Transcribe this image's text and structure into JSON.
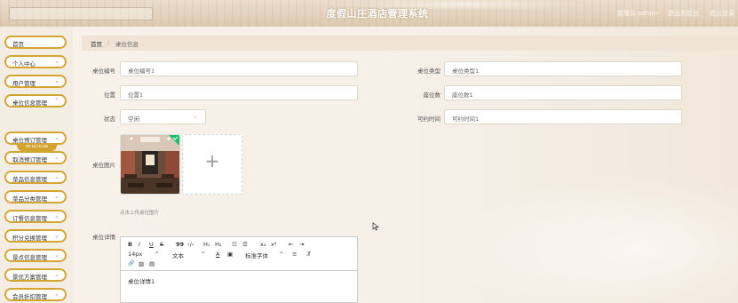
{
  "header": {
    "title": "度假山庄酒店管理系统",
    "links": [
      "管理员 admin",
      "退出到前台",
      "退出登录"
    ]
  },
  "sidebar": {
    "items": [
      {
        "label": "首页",
        "chev": ""
      },
      {
        "label": "个人中心",
        "chev": "⌄"
      },
      {
        "label": "用户管理",
        "chev": "⌄"
      },
      {
        "label": "桌位信息管理",
        "chev": "⌃"
      },
      {
        "label": "桌位预订管理",
        "chev": "⌄"
      },
      {
        "label": "取消预订管理",
        "chev": "⌄"
      },
      {
        "label": "菜品信息管理",
        "chev": "⌄"
      },
      {
        "label": "菜品分类管理",
        "chev": "⌄"
      },
      {
        "label": "订餐信息管理",
        "chev": "⌄"
      },
      {
        "label": "积分兑换管理",
        "chev": "⌄"
      },
      {
        "label": "景点信息管理",
        "chev": "⌄"
      },
      {
        "label": "景优方案管理",
        "chev": "⌄"
      },
      {
        "label": "会员折扣管理",
        "chev": "⌄"
      }
    ],
    "active_submenu": "桌位信息"
  },
  "breadcrumb": {
    "home": "首页",
    "separator": "/",
    "current": "桌位信息"
  },
  "form": {
    "table_no_label": "桌位编号",
    "table_no_value": "桌位编号1",
    "table_type_label": "桌位类型",
    "table_type_value": "桌位类型1",
    "location_label": "位置",
    "location_value": "位置1",
    "seats_label": "座位数",
    "seats_value": "座位数1",
    "status_label": "状态",
    "status_value": "空闲",
    "time_label": "可约时间",
    "time_value": "可约时间1",
    "image_label": "桌位图片",
    "upload_hint": "点击上传桌位图片",
    "detail_label": "桌位详情",
    "detail_value": "桌位详情1"
  },
  "editor_toolbar": {
    "bold": "B",
    "italic": "I",
    "underline": "U",
    "strike": "S",
    "quote": "99",
    "code": "‹/›",
    "h1": "H₁",
    "h2": "H₂",
    "ol": "☷",
    "ul": "☰",
    "sub": "x₂",
    "sup": "x²",
    "outdent": "⇤",
    "indent": "⇥",
    "size": "14px",
    "size_chev": "⌃",
    "text": "文本",
    "text_chev": "⌃",
    "color": "A",
    "bg": "▣",
    "font": "标准字体",
    "font_chev": "⌃",
    "align": "≡",
    "clear": "T̸",
    "link": "🔗",
    "image": "▨",
    "video": "▤"
  },
  "colors": {
    "accent": "#d4a631",
    "active": "#d2a32d",
    "check": "#19be6b"
  }
}
